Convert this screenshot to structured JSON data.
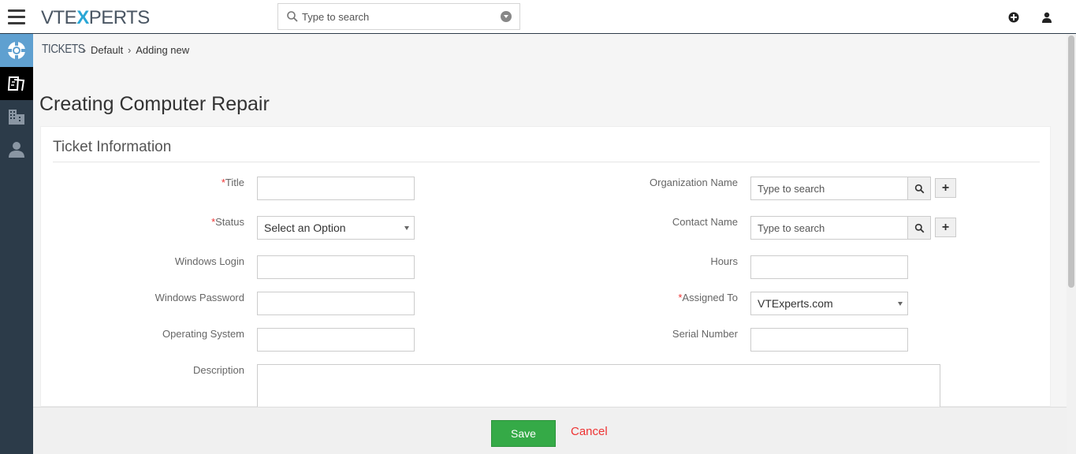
{
  "app": {
    "logo_prefix": "VTE",
    "logo_x": "X",
    "logo_suffix": "PERTS"
  },
  "search": {
    "placeholder": "Type to search"
  },
  "topbar": {
    "icons": [
      "plus-circle-icon",
      "user-icon"
    ]
  },
  "sidebar": {
    "items": [
      {
        "name": "support-icon",
        "active": true
      },
      {
        "name": "tickets-icon",
        "active": true
      },
      {
        "name": "organizations-icon",
        "active": false
      },
      {
        "name": "contacts-icon",
        "active": false
      }
    ]
  },
  "breadcrumb": {
    "module": "TICKETS",
    "items": [
      "Default",
      "Adding new"
    ]
  },
  "page": {
    "title": "Creating Computer Repair"
  },
  "form": {
    "section_title": "Ticket Information",
    "required_mark": "*",
    "title_label": "Title",
    "title_value": "",
    "status_label": "Status",
    "status_value": "Select an Option",
    "windows_login_label": "Windows Login",
    "windows_password_label": "Windows Password",
    "operating_system_label": "Operating System",
    "description_label": "Description",
    "organization_label": "Organization Name",
    "organization_placeholder": "Type to search",
    "contact_label": "Contact Name",
    "contact_placeholder": "Type to search",
    "hours_label": "Hours",
    "assigned_to_label": "Assigned To",
    "assigned_to_value": "VTExperts.com",
    "serial_number_label": "Serial Number"
  },
  "footer": {
    "save_label": "Save",
    "cancel_label": "Cancel"
  },
  "colors": {
    "sidebar": "#2c3b49",
    "save": "#35aa47",
    "required": "#e33333",
    "accent": "#2aa7d6"
  }
}
